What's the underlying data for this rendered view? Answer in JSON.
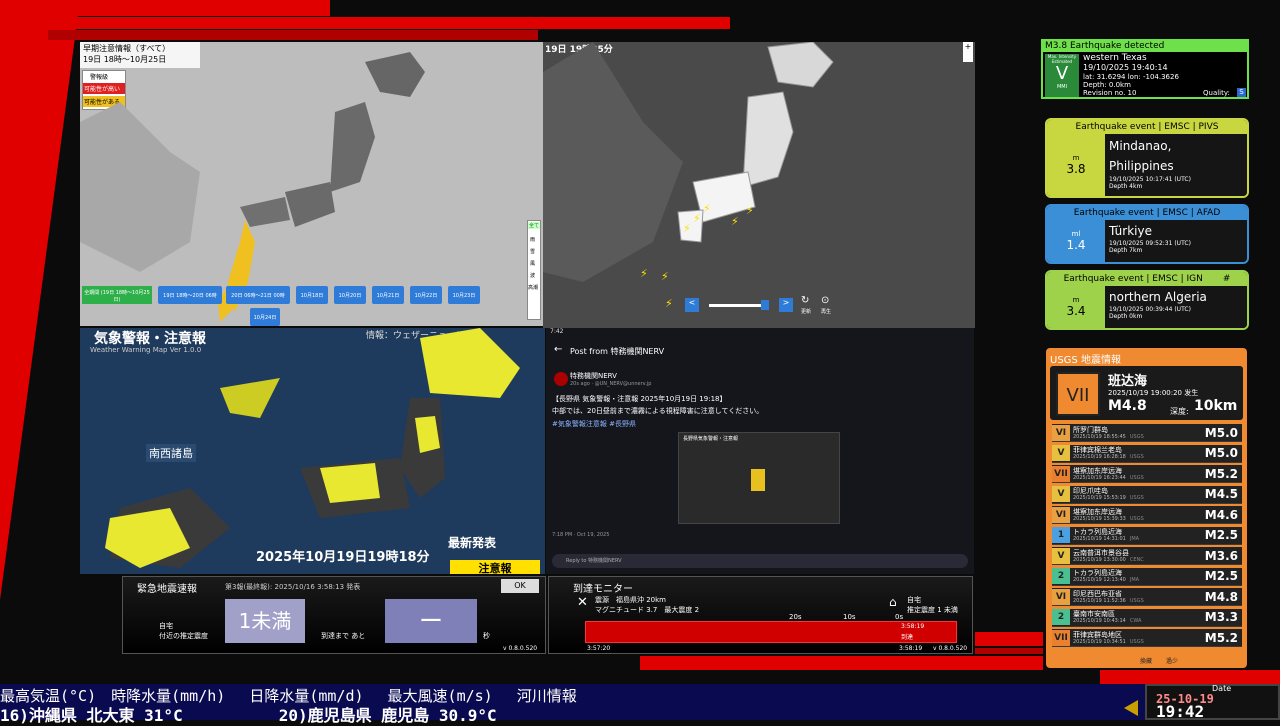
{
  "top_left_map": {
    "title_line1": "早期注意情報（すべて）",
    "title_line2": "19日 18時〜10月25日",
    "legend_title": "警報級",
    "legend_high": "可能性が高い",
    "legend_mid": "可能性がある",
    "all_period": "全期間\n(19日 18時〜10月25日)",
    "buttons": [
      "19日 18時〜20日 06時",
      "20日 06時〜21日 00時",
      "10月18日",
      "10月20日",
      "10月21日",
      "10月22日",
      "10月23日",
      "10月24日"
    ],
    "side_buttons": [
      "全て",
      "雨",
      "雪",
      "風",
      "波",
      "高潮"
    ]
  },
  "top_right_map": {
    "timestamp": "19日 19時35分",
    "btn_update": "更新",
    "btn_play": "再生"
  },
  "warning_map": {
    "title": "気象警報・注意報",
    "subtitle": "Weather Warning Map Ver 1.0.0",
    "info": "情報：ウェザーニュース",
    "region": "南西諸島",
    "latest": "最新発表",
    "datetime": "2025年10月19日19時18分",
    "tag": "注意報"
  },
  "post": {
    "status_time": "7:42",
    "header": "Post from 特務機関NERV",
    "account": "特務機関NERV",
    "meta": "20s ago · @UN_NERV@unnerv.jp",
    "line1": "【長野県 気象警報・注意報 2025年10月19日 19:18】",
    "line2": "中部では、20日昼前まで濃霧による視程障害に注意してください。",
    "tags": "#気象警報注意報 #長野県",
    "image_caption": "長野県気象警報・注意報",
    "footer_time": "7:18 PM · Oct 19, 2025",
    "reply_placeholder": "Reply to 特務機関NERV"
  },
  "eew": {
    "title": "緊急地震速報",
    "report": "第3報(最終報): 2025/10/16 3:58:13 発表",
    "ok": "OK",
    "label_home": "自宅",
    "label_intensity": "付近の推定震度",
    "intensity": "1未満",
    "label_until": "到達まで あと",
    "countdown": "ー",
    "unit_sec": "秒",
    "version": "v 0.8.0.520"
  },
  "arrival": {
    "title": "到達モニター",
    "source": "震源　福島県沖 20km",
    "magnitude": "マグニチュード 3.7　最大震度 2",
    "home": "自宅",
    "home_est": "推定震度 1 未満",
    "ticks": [
      "20s",
      "10s",
      "0s"
    ],
    "arrive_time": "3:58:19",
    "arrive_label": "到達",
    "start_time": "3:57:20",
    "end_time": "3:58:19",
    "version": "v 0.8.0.520"
  },
  "detected": {
    "title": "M3.8 Earthquake detected",
    "max_label": "Max. Intensity Estimated",
    "intensity": "V",
    "scale": "MMI",
    "place": "western Texas",
    "time": "19/10/2025 19:40:14",
    "coords": "lat: 31.6294 lon: -104.3626",
    "depth": "Depth: 0.0km",
    "revision": "Revision no. 10",
    "quality_label": "Quality:",
    "quality": "S"
  },
  "events": [
    {
      "header": "Earthquake event | EMSC | PIVS",
      "scale": "m",
      "mag": "3.8",
      "place": "Mindanao, Philippines",
      "time": "19/10/2025 10:17:41 (UTC)",
      "depth": "Depth 4km",
      "color": "#c8d640"
    },
    {
      "header": "Earthquake event | EMSC | AFAD",
      "scale": "ml",
      "mag": "1.4",
      "place": "Türkiye",
      "time": "19/10/2025 09:52:31 (UTC)",
      "depth": "Depth 7km",
      "color": "#3a8fd6"
    },
    {
      "header": "Earthquake event | EMSC | IGN",
      "hash": "#",
      "scale": "m",
      "mag": "3.4",
      "place": "northern Algeria",
      "time": "19/10/2025 00:39:44 (UTC)",
      "depth": "Depth 0km",
      "color": "#9ed24a"
    }
  ],
  "usgs": {
    "title": "USGS 地震情報",
    "main_int": "VII",
    "main_place": "班达海",
    "main_time": "2025/10/19 19:00:20 发生",
    "main_mag": "M4.8",
    "depth_label": "深度:",
    "depth": "10km",
    "rows": [
      {
        "int": "VI",
        "c": "#e8a040",
        "name": "所罗门群岛",
        "time": "2025/10/19 18:55:45",
        "src": "USGS",
        "mag": "M5.0"
      },
      {
        "int": "V",
        "c": "#e8c040",
        "name": "菲律宾棉兰老岛",
        "time": "2025/10/19 16:28:18",
        "src": "USGS",
        "mag": "M5.0"
      },
      {
        "int": "VII",
        "c": "#e88030",
        "name": "堪察加东岸远海",
        "time": "2025/10/19 16:23:44",
        "src": "USGS",
        "mag": "M5.2"
      },
      {
        "int": "V",
        "c": "#e8c040",
        "name": "印尼爪哇岛",
        "time": "2025/10/19 15:53:19",
        "src": "USGS",
        "mag": "M4.5"
      },
      {
        "int": "VI",
        "c": "#e8a040",
        "name": "堪察加东岸远海",
        "time": "2025/10/19 15:39:33",
        "src": "USGS",
        "mag": "M4.6"
      },
      {
        "int": "1",
        "c": "#4aa0e0",
        "name": "トカラ列島近海",
        "time": "2025/10/19 14:31:01",
        "src": "JMA",
        "mag": "M2.5"
      },
      {
        "int": "V",
        "c": "#e8c040",
        "name": "云南普洱市景谷县",
        "time": "2025/10/19 13:30:00",
        "src": "CENC",
        "mag": "M3.6"
      },
      {
        "int": "2",
        "c": "#4ac090",
        "name": "トカラ列島近海",
        "time": "2025/10/19 12:13:40",
        "src": "JMA",
        "mag": "M2.5"
      },
      {
        "int": "VI",
        "c": "#e8a040",
        "name": "印尼西巴布亚省",
        "time": "2025/10/19 11:52:36",
        "src": "USGS",
        "mag": "M4.8"
      },
      {
        "int": "2",
        "c": "#4ac090",
        "name": "臺南市安南區",
        "time": "2025/10/19 10:43:14",
        "src": "CWA",
        "mag": "M3.3"
      },
      {
        "int": "VII",
        "c": "#e88030",
        "name": "菲律宾群岛地区",
        "time": "2025/10/19 10:34:51",
        "src": "USGS",
        "mag": "M5.2"
      }
    ],
    "footer1": "換藏",
    "footer2": "過少"
  },
  "ticker": {
    "line1": "最高気温(°C)　時降水量(mm/h)　 日降水量(mm/d)　 最大風速(m/s)　 河川情報",
    "line2": "16)沖縄県 北大東 31°C　　　　　　20)鹿児島県 鹿児島 30.9°C",
    "date_label": "Date",
    "date": "25-10-19",
    "time": "19:42"
  }
}
